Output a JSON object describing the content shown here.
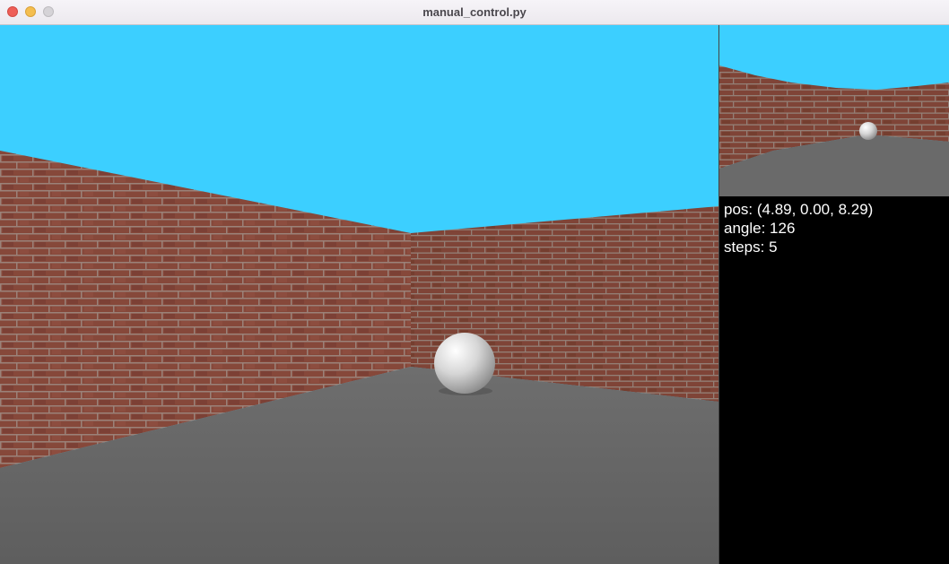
{
  "window": {
    "title": "manual_control.py"
  },
  "colors": {
    "sky": "#3ccfff",
    "brick": "#8a4a3c",
    "mortar": "#a08a80",
    "floor": "#6a6a6a",
    "ball": "#e8e8e8"
  },
  "scene": {
    "objects": [
      "brick-wall-left",
      "brick-wall-back",
      "concrete-floor",
      "white-sphere"
    ]
  },
  "status": {
    "pos": "pos: (4.89, 0.00, 8.29)",
    "angle": "angle: 126",
    "steps": "steps: 5"
  }
}
